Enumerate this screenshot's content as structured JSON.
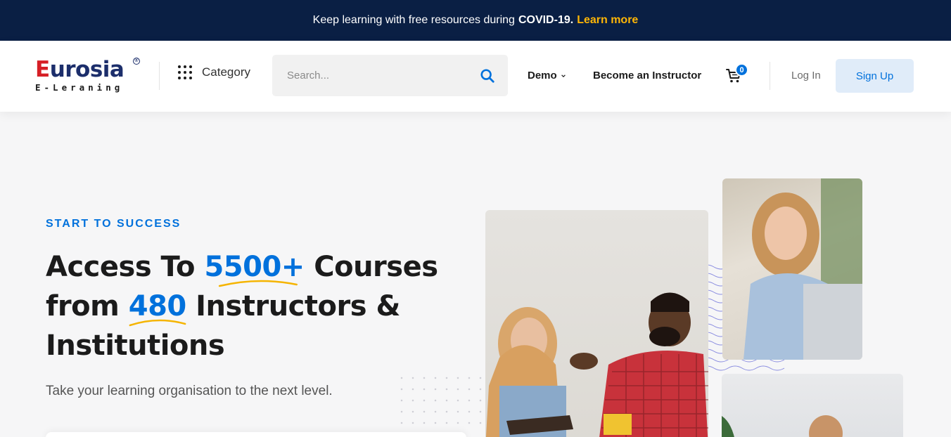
{
  "banner": {
    "text": "Keep learning with free resources during",
    "highlight": "COVID-19.",
    "link": "Learn more",
    "link_color": "#ffb606",
    "background": "#0a1f44"
  },
  "header": {
    "logo": {
      "name": "Eurosia",
      "tagline": "E-Leraning",
      "registered": "®"
    },
    "category_label": "Category",
    "search": {
      "placeholder": "Search...",
      "value": ""
    },
    "nav": {
      "demo": "Demo",
      "instructor": "Become an Instructor"
    },
    "cart_count": "0",
    "login": "Log In",
    "signup": "Sign Up",
    "accent_color": "#0071dc"
  },
  "hero": {
    "eyebrow": "START TO SUCCESS",
    "headline": {
      "part1": "Access To",
      "num1": "5500+",
      "part2": "Courses",
      "part3": "from",
      "num2": "480",
      "part4": "Instructors &",
      "part5": "Institutions"
    },
    "subtext": "Take your learning organisation to the next level.",
    "underline_color": "#f5b400"
  },
  "images": [
    "photo-students-discussion",
    "photo-woman-laptop",
    "photo-bottom-partial"
  ]
}
